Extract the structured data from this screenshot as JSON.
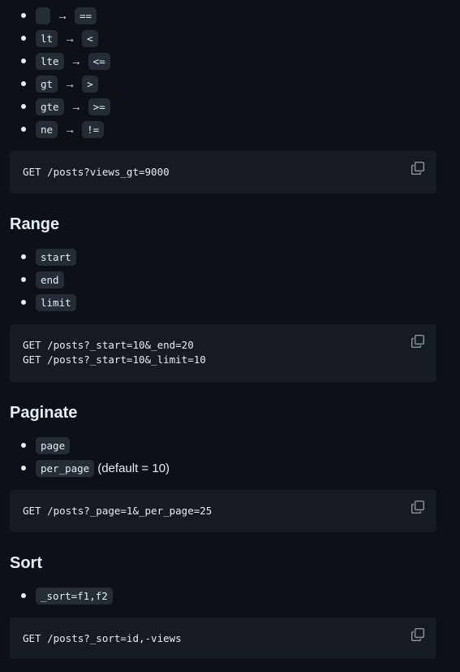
{
  "operators": [
    {
      "op": "",
      "symbol": "=="
    },
    {
      "op": "lt",
      "symbol": "<"
    },
    {
      "op": "lte",
      "symbol": "<="
    },
    {
      "op": "gt",
      "symbol": ">"
    },
    {
      "op": "gte",
      "symbol": ">="
    },
    {
      "op": "ne",
      "symbol": "!="
    }
  ],
  "arrow": "→",
  "operators_code": "GET /posts?views_gt=9000",
  "range": {
    "heading": "Range",
    "items": [
      "start",
      "end",
      "limit"
    ],
    "code_lines": [
      "GET /posts?_start=10&_end=20",
      "GET /posts?_start=10&_limit=10"
    ]
  },
  "paginate": {
    "heading": "Paginate",
    "items": [
      {
        "code": "page",
        "note": ""
      },
      {
        "code": "per_page",
        "note": "(default = 10)"
      }
    ],
    "code": "GET /posts?_page=1&_per_page=25"
  },
  "sort": {
    "heading": "Sort",
    "items": [
      "_sort=f1,f2"
    ],
    "code": "GET /posts?_sort=id,-views"
  },
  "icons": {
    "copy": "copy-icon"
  }
}
